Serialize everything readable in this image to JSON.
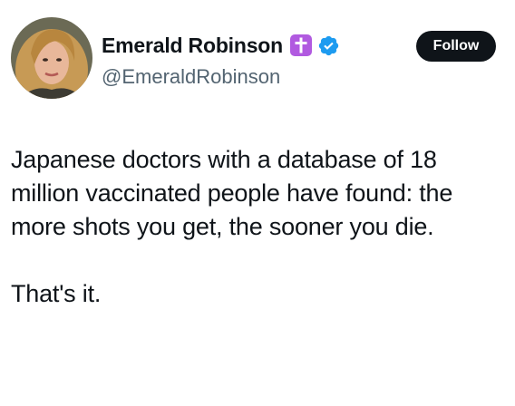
{
  "author": {
    "display_name": "Emerald Robinson",
    "handle": "@EmeraldRobinson",
    "badge_icons": [
      "cross-icon",
      "verified-icon"
    ],
    "avatar_icon": "profile-photo"
  },
  "actions": {
    "follow_label": "Follow"
  },
  "tweet": {
    "paragraph_1": "Japanese doctors with a database of 18 million vaccinated people have found: the more shots you get, the sooner you die.",
    "paragraph_2": "That's it."
  },
  "colors": {
    "text": "#0f1419",
    "secondary_text": "#536471",
    "follow_bg": "#0f1419",
    "cross_badge": "#b15ae0",
    "verified_badge": "#1d9bf0"
  }
}
